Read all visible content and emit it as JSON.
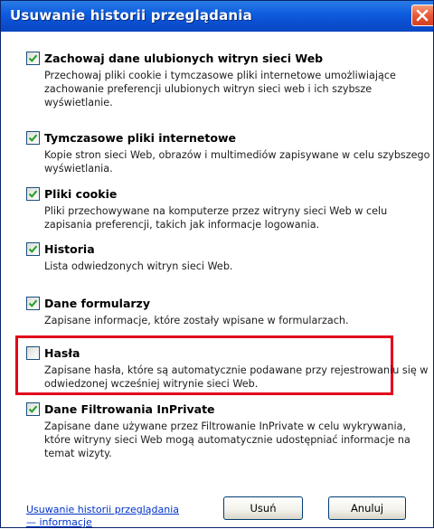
{
  "window": {
    "title": "Usuwanie historii przeglądania"
  },
  "items": [
    {
      "label": "Zachowaj dane ulubionych witryn sieci Web",
      "checked": true,
      "description": "Przechowaj pliki cookie i tymczasowe pliki internetowe umożliwiające zachowanie preferencji ulubionych witryn sieci web i ich szybsze wyświetlanie."
    },
    {
      "label": "Tymczasowe pliki internetowe",
      "checked": true,
      "description": "Kopie stron sieci Web, obrazów i multimediów zapisywane w celu szybszego wyświetlania."
    },
    {
      "label": "Pliki cookie",
      "checked": true,
      "description": "Pliki przechowywane na komputerze przez witryny sieci Web w celu zapisania preferencji, takich jak informacje logowania."
    },
    {
      "label": "Historia",
      "checked": true,
      "description": "Lista odwiedzonych witryn sieci Web."
    },
    {
      "label": "Dane formularzy",
      "checked": true,
      "description": "Zapisane informacje, które zostały wpisane w formularzach."
    },
    {
      "label": "Hasła",
      "checked": false,
      "description": "Zapisane hasła, które są automatycznie podawane przy rejestrowaniu się w odwiedzonej wcześniej witrynie sieci Web."
    },
    {
      "label": "Dane Filtrowania InPrivate",
      "checked": true,
      "description": "Zapisane dane używane przez Filtrowanie InPrivate w celu wykrywania, które witryny sieci Web mogą automatycznie udostępniać informacje na temat wizyty."
    }
  ],
  "footer": {
    "link_line1": "Usuwanie historii przeglądania",
    "link_line2": "— informacje",
    "delete_label": "Usuń",
    "cancel_label": "Anuluj"
  },
  "colors": {
    "titlebar": "#0b4fd0",
    "highlight_border": "#e0001b",
    "link": "#0033cc"
  },
  "icons": {
    "close": "close-icon",
    "check": "checkmark-icon"
  }
}
